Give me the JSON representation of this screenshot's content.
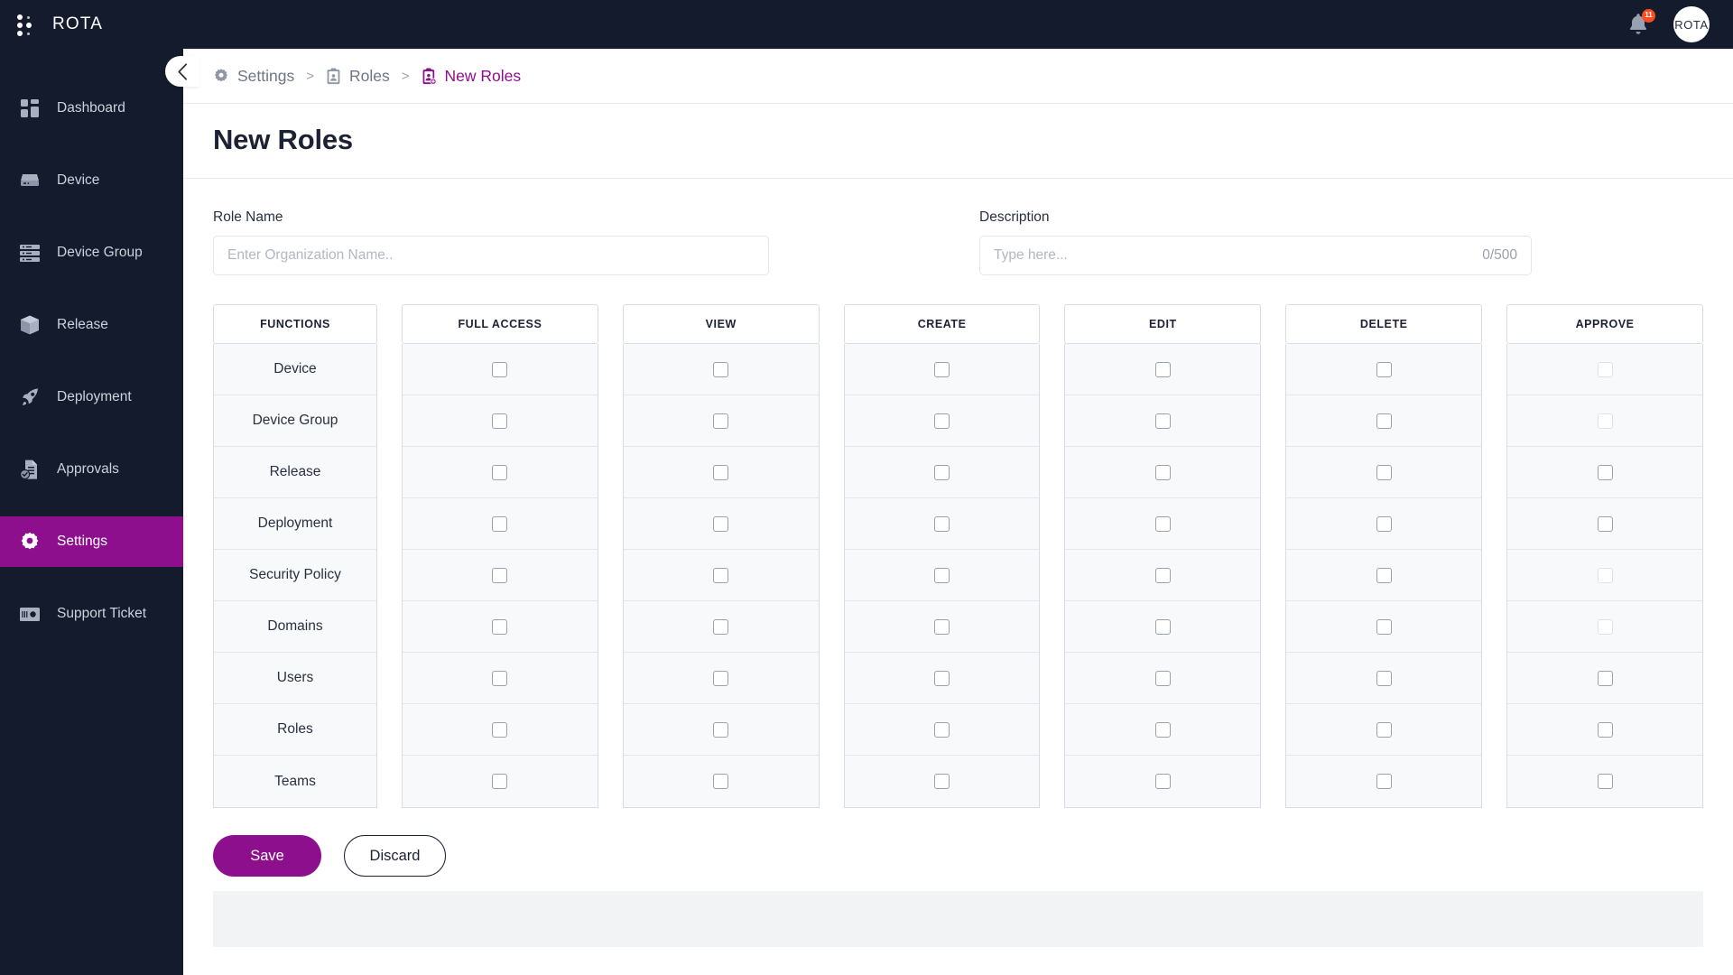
{
  "topbar": {
    "brand": "ROTA",
    "logo_icon": "six-dots-icon",
    "notification_icon": "bell-icon",
    "notification_badge": "11",
    "avatar_label": "ROTA"
  },
  "sidebar": {
    "collapse_icon": "chevron-left-icon",
    "items": [
      {
        "label": "Dashboard",
        "icon": "dashboard-grid-icon",
        "active": false
      },
      {
        "label": "Device",
        "icon": "server-device-icon",
        "active": false
      },
      {
        "label": "Device Group",
        "icon": "server-stack-icon",
        "active": false
      },
      {
        "label": "Release",
        "icon": "cube-box-icon",
        "active": false
      },
      {
        "label": "Deployment",
        "icon": "rocket-icon",
        "active": false
      },
      {
        "label": "Approvals",
        "icon": "document-check-icon",
        "active": false
      },
      {
        "label": "Settings",
        "icon": "gear-icon",
        "active": true
      },
      {
        "label": "Support Ticket",
        "icon": "ticket-icon",
        "active": false
      }
    ]
  },
  "breadcrumb": [
    {
      "label": "Settings",
      "icon": "gear-icon",
      "current": false
    },
    {
      "label": "Roles",
      "icon": "clipboard-icon",
      "current": false
    },
    {
      "label": "New Roles",
      "icon": "clipboard-add-icon",
      "current": true
    }
  ],
  "breadcrumb_separator": ">",
  "page": {
    "title": "New Roles"
  },
  "form": {
    "role_name": {
      "label": "Role Name",
      "value": "",
      "placeholder": "Enter Organization Name.."
    },
    "description": {
      "label": "Description",
      "value": "",
      "placeholder": "Type here...",
      "counter": "0/500"
    }
  },
  "permissions": {
    "columns": [
      "FUNCTIONS",
      "FULL ACCESS",
      "VIEW",
      "CREATE",
      "EDIT",
      "DELETE",
      "APPROVE"
    ],
    "rows": [
      {
        "function": "Device",
        "full_access": false,
        "view": false,
        "create": false,
        "edit": false,
        "delete": false,
        "approve": false,
        "approve_disabled": true
      },
      {
        "function": "Device Group",
        "full_access": false,
        "view": false,
        "create": false,
        "edit": false,
        "delete": false,
        "approve": false,
        "approve_disabled": true
      },
      {
        "function": "Release",
        "full_access": false,
        "view": false,
        "create": false,
        "edit": false,
        "delete": false,
        "approve": false,
        "approve_disabled": false
      },
      {
        "function": "Deployment",
        "full_access": false,
        "view": false,
        "create": false,
        "edit": false,
        "delete": false,
        "approve": false,
        "approve_disabled": false
      },
      {
        "function": "Security Policy",
        "full_access": false,
        "view": false,
        "create": false,
        "edit": false,
        "delete": false,
        "approve": false,
        "approve_disabled": true
      },
      {
        "function": "Domains",
        "full_access": false,
        "view": false,
        "create": false,
        "edit": false,
        "delete": false,
        "approve": false,
        "approve_disabled": true
      },
      {
        "function": "Users",
        "full_access": false,
        "view": false,
        "create": false,
        "edit": false,
        "delete": false,
        "approve": false,
        "approve_disabled": false
      },
      {
        "function": "Roles",
        "full_access": false,
        "view": false,
        "create": false,
        "edit": false,
        "delete": false,
        "approve": false,
        "approve_disabled": false
      },
      {
        "function": "Teams",
        "full_access": false,
        "view": false,
        "create": false,
        "edit": false,
        "delete": false,
        "approve": false,
        "approve_disabled": false
      }
    ]
  },
  "actions": {
    "save_label": "Save",
    "discard_label": "Discard"
  },
  "colors": {
    "accent": "#8d0f8d",
    "sidebar": "#141b2d",
    "badge": "#ff4d20",
    "text": "#1c2233"
  }
}
